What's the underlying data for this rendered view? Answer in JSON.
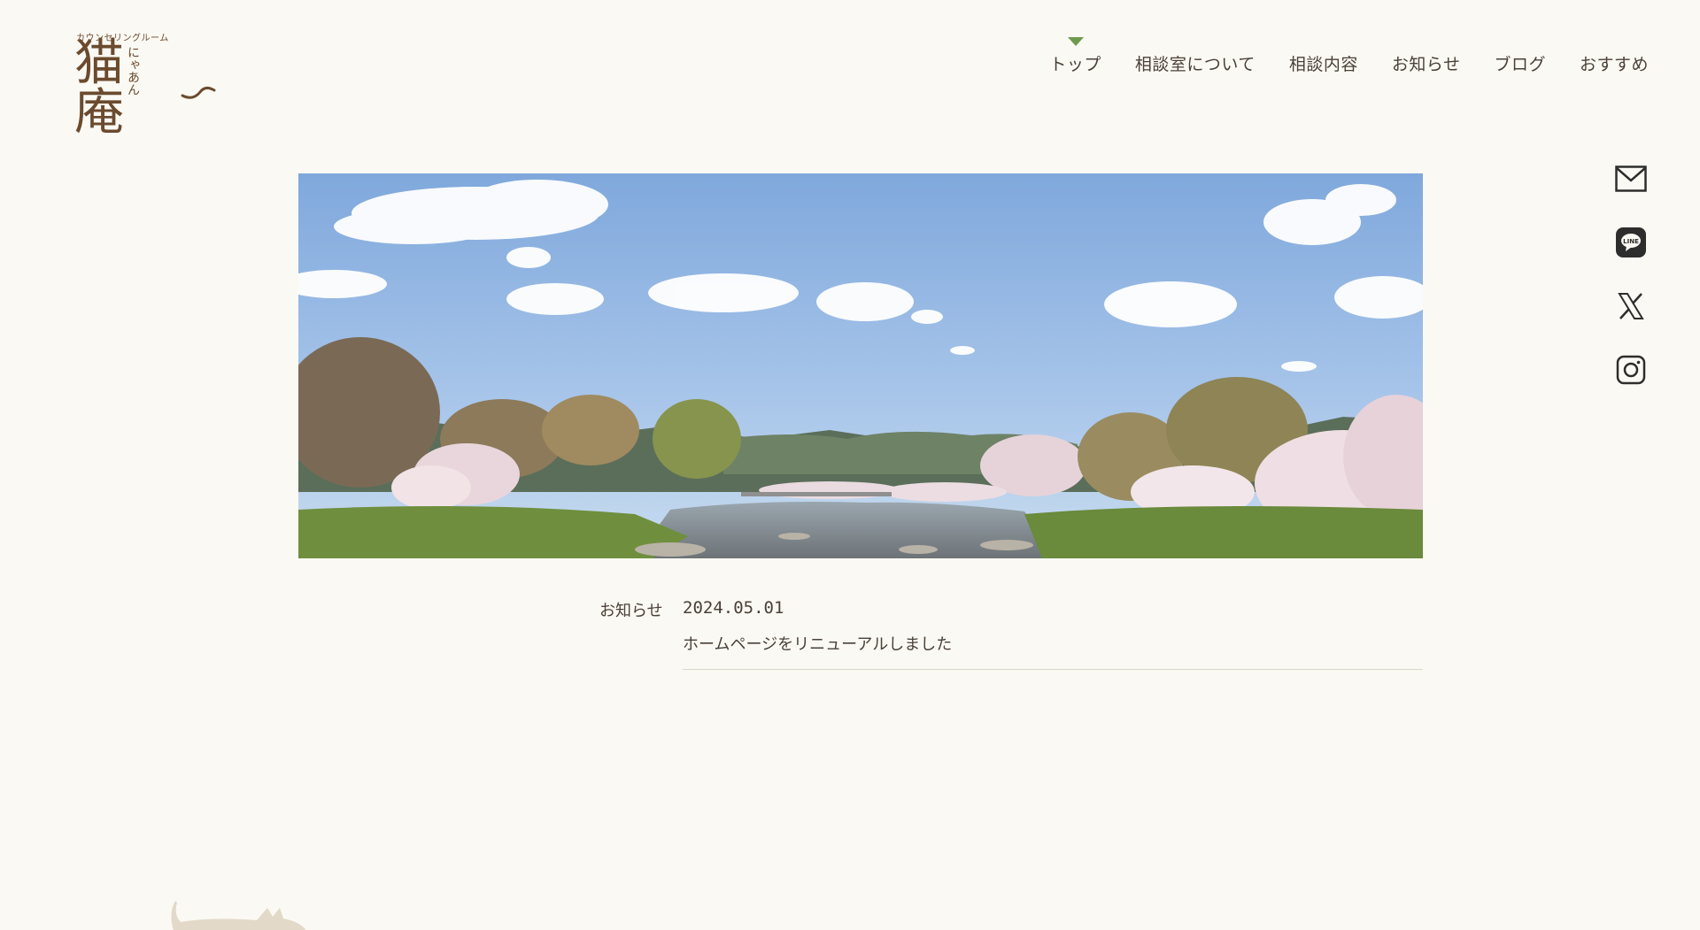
{
  "logo": {
    "subtitle": "カウンセリングルーム",
    "main": "猫庵",
    "kana": "にゃあん"
  },
  "nav": {
    "items": [
      {
        "label": "トップ",
        "active": true
      },
      {
        "label": "相談室について"
      },
      {
        "label": "相談内容"
      },
      {
        "label": "お知らせ"
      },
      {
        "label": "ブログ"
      },
      {
        "label": "おすすめ"
      }
    ]
  },
  "side_icons": [
    "mail-icon",
    "line-icon",
    "x-icon",
    "instagram-icon"
  ],
  "side_labels": {
    "line": "LINE"
  },
  "hero": {
    "alt": ""
  },
  "news": {
    "label": "お知らせ",
    "entries": [
      {
        "date": "2024.05.01",
        "title": "ホームページをリニューアルしました"
      }
    ]
  },
  "colors": {
    "background": "#fbf9f3",
    "brand": "#6b4a2e",
    "accent": "#6e9a4e",
    "text": "#4a4038"
  }
}
